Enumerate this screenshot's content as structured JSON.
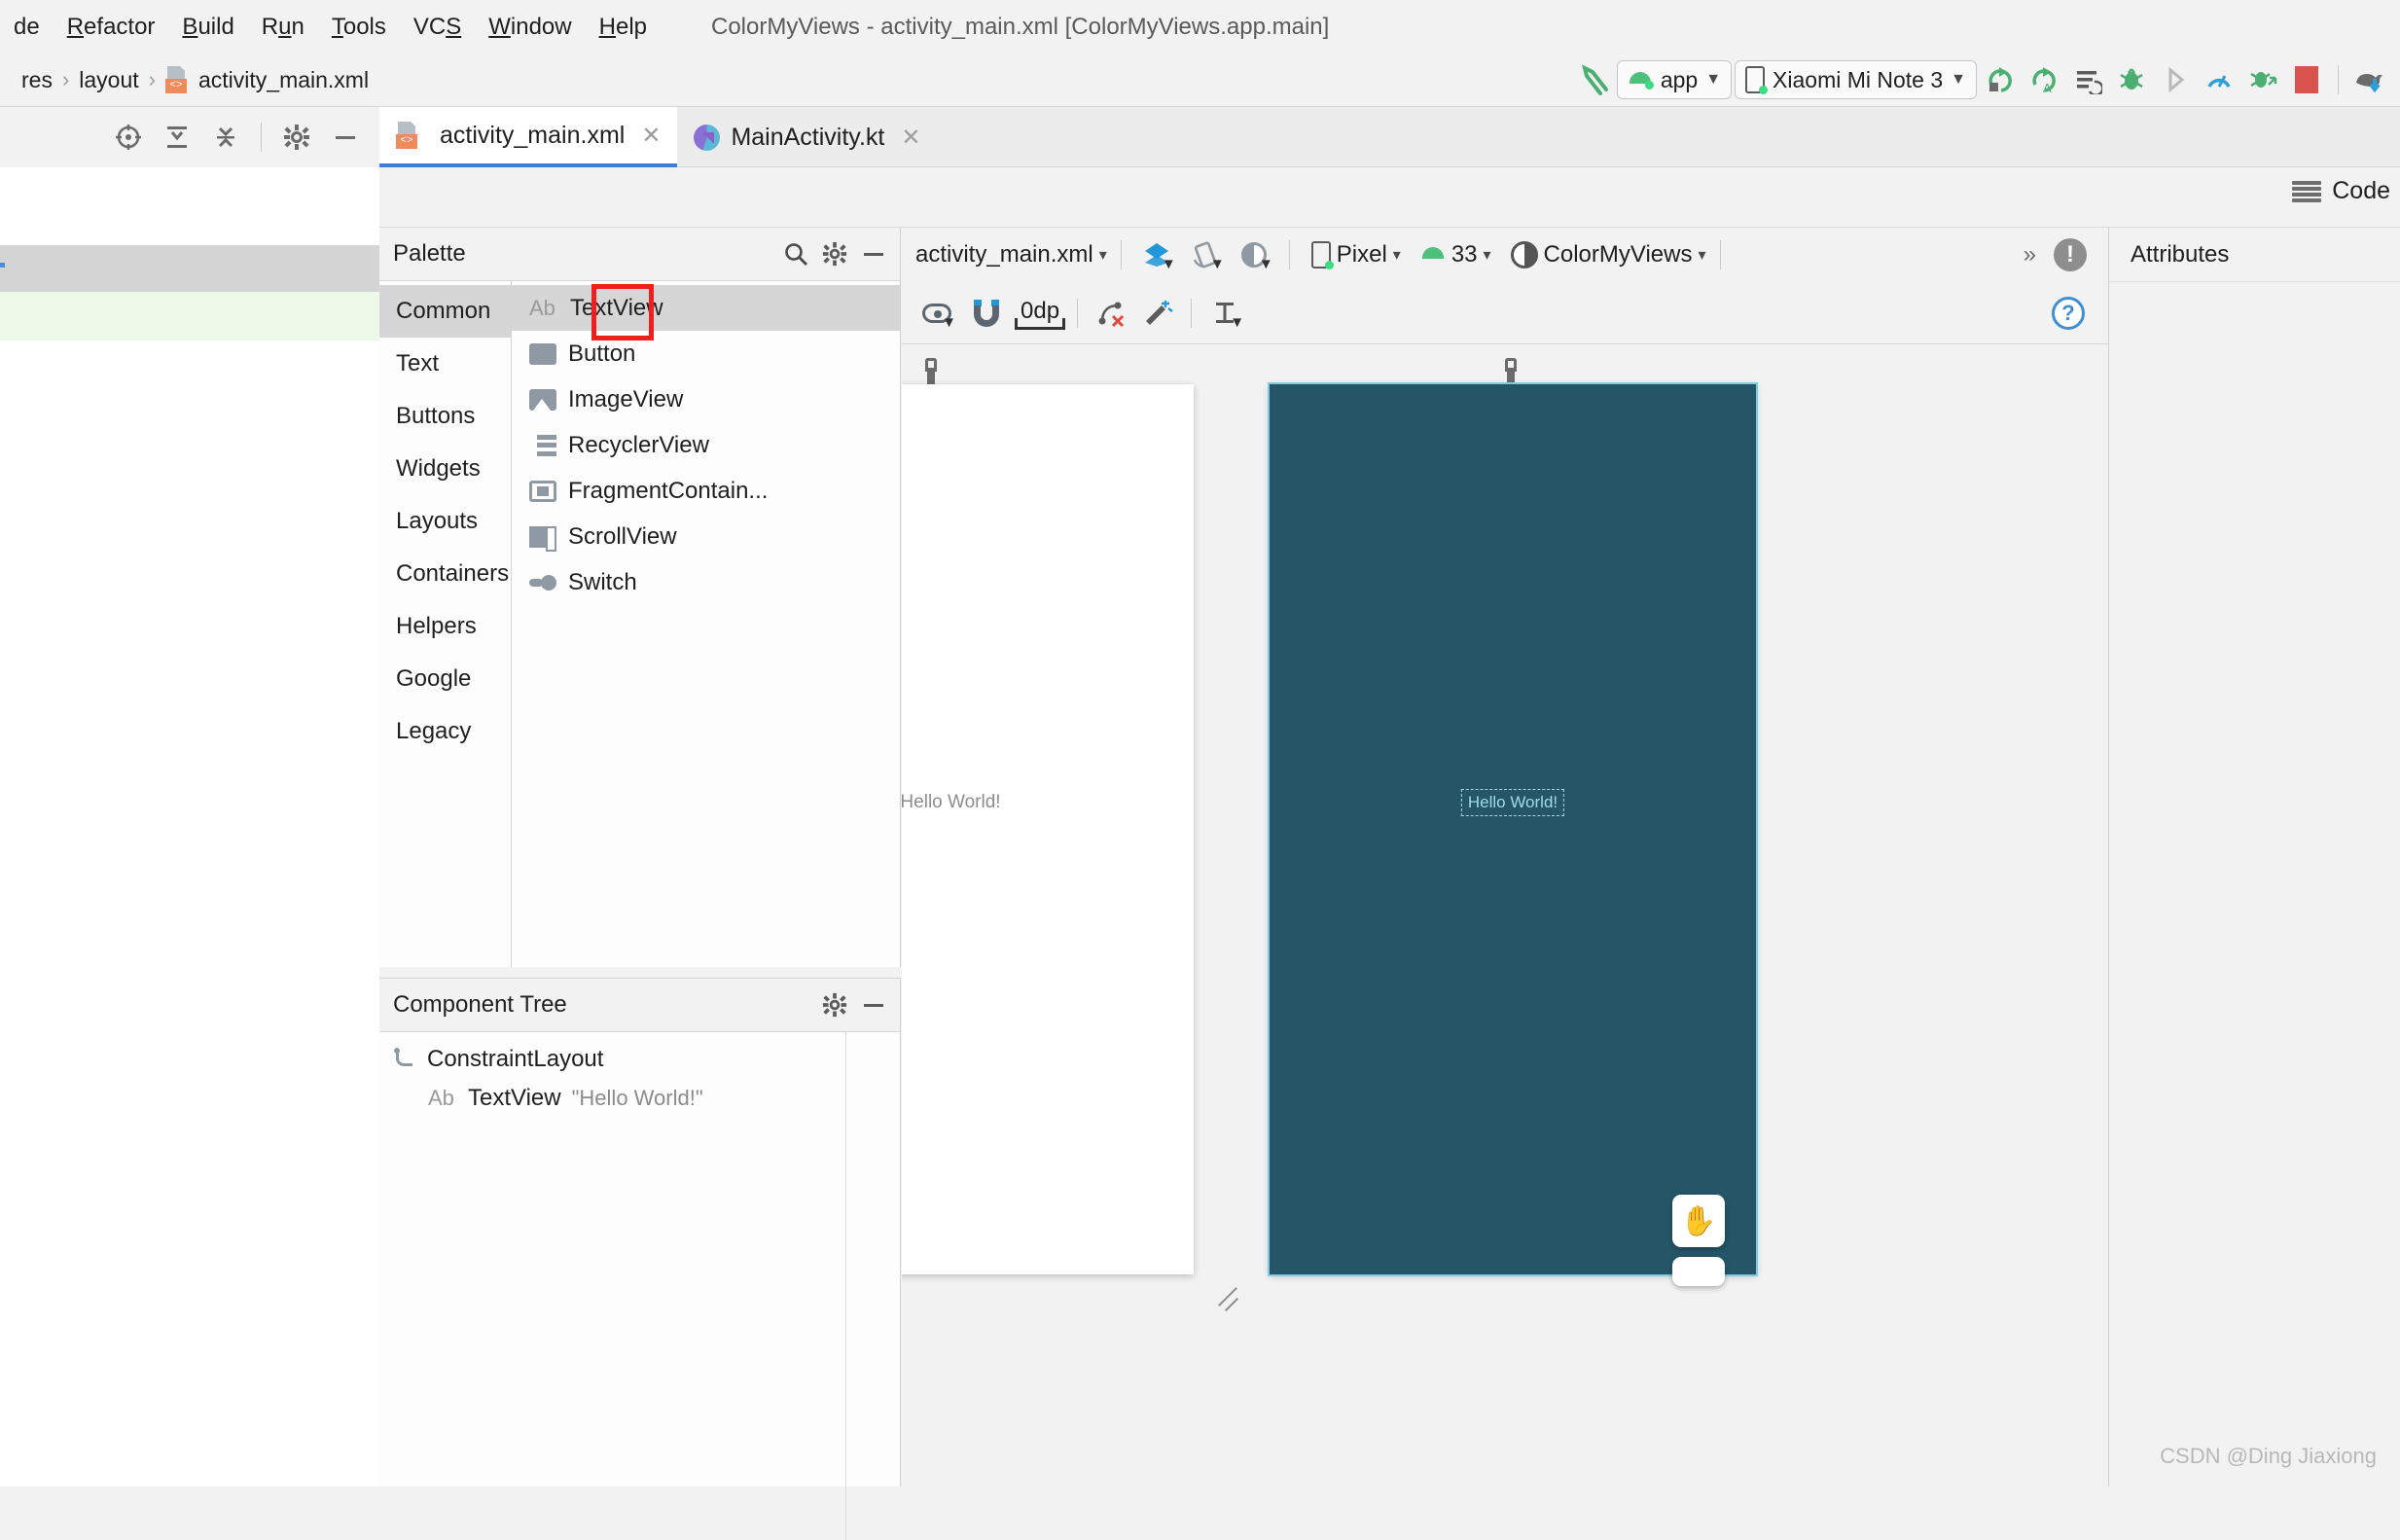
{
  "window": {
    "title": "ColorMyViews - activity_main.xml [ColorMyViews.app.main]"
  },
  "menubar": {
    "items": [
      {
        "label": "de",
        "mnemonic": ""
      },
      {
        "label": "Refactor",
        "mnemonic": "R"
      },
      {
        "label": "Build",
        "mnemonic": "B"
      },
      {
        "label": "Run",
        "mnemonic": "u"
      },
      {
        "label": "Tools",
        "mnemonic": "T"
      },
      {
        "label": "VCS",
        "mnemonic": "S"
      },
      {
        "label": "Window",
        "mnemonic": "W"
      },
      {
        "label": "Help",
        "mnemonic": "H"
      }
    ]
  },
  "breadcrumb": {
    "items": [
      "res",
      "layout",
      "activity_main.xml"
    ],
    "separator": "›"
  },
  "toolbar": {
    "run_config_label": "app",
    "device_label": "Xiaomi Mi Note 3",
    "icons": [
      "back-arrow-icon",
      "run-icon",
      "run-with-coverage-icon",
      "apply-changes-icon",
      "debug-icon",
      "step-icon",
      "profiler-icon",
      "attach-debugger-icon",
      "stop-icon",
      "gradle-sync-icon"
    ]
  },
  "left_tools": {
    "icons": [
      "target-icon",
      "expand-all-icon",
      "collapse-all-icon",
      "settings-icon",
      "hide-icon"
    ]
  },
  "tabs": [
    {
      "label": "activity_main.xml",
      "icon": "xml-layout-icon",
      "active": true,
      "close": "✕"
    },
    {
      "label": "MainActivity.kt",
      "icon": "kotlin-icon",
      "active": false,
      "close": "✕"
    }
  ],
  "editor_mode": {
    "label": "Code",
    "icon": "split-editor-icon"
  },
  "palette": {
    "title": "Palette",
    "actions": [
      "search-icon",
      "gear-icon",
      "minimize-icon"
    ],
    "categories": [
      {
        "label": "Common",
        "selected": true
      },
      {
        "label": "Text",
        "selected": false
      },
      {
        "label": "Buttons",
        "selected": false
      },
      {
        "label": "Widgets",
        "selected": false
      },
      {
        "label": "Layouts",
        "selected": false
      },
      {
        "label": "Containers",
        "selected": false
      },
      {
        "label": "Helpers",
        "selected": false
      },
      {
        "label": "Google",
        "selected": false
      },
      {
        "label": "Legacy",
        "selected": false
      }
    ],
    "items": [
      {
        "label": "TextView",
        "icon": "ab-icon",
        "selected": true
      },
      {
        "label": "Button",
        "icon": "button-icon",
        "selected": false
      },
      {
        "label": "ImageView",
        "icon": "image-icon",
        "selected": false
      },
      {
        "label": "RecyclerView",
        "icon": "list-icon",
        "selected": false
      },
      {
        "label": "FragmentContain...",
        "icon": "fragment-icon",
        "selected": false
      },
      {
        "label": "ScrollView",
        "icon": "scroll-icon",
        "selected": false
      },
      {
        "label": "Switch",
        "icon": "switch-icon",
        "selected": false
      }
    ]
  },
  "component_tree": {
    "title": "Component Tree",
    "actions": [
      "gear-icon",
      "minimize-icon"
    ],
    "nodes": [
      {
        "label": "ConstraintLayout",
        "value": "",
        "icon": "constraint-layout-icon",
        "level": 0
      },
      {
        "label": "TextView",
        "value": "\"Hello World!\"",
        "icon": "ab-icon",
        "level": 1
      }
    ]
  },
  "design_toolbar": {
    "file_label": "activity_main.xml",
    "device_label": "Pixel",
    "api_label": "33",
    "theme_label": "ColorMyViews",
    "overflow": "»",
    "icons": [
      "design-mode-icon",
      "orientation-icon",
      "night-mode-icon",
      "device-icon",
      "api-icon",
      "theme-icon",
      "issues-icon"
    ]
  },
  "constraint_toolbar": {
    "margin_value": "0dp",
    "highlighted_icon": "autoconnect-magnet-icon",
    "icons": [
      "view-options-eye-icon",
      "autoconnect-magnet-icon",
      "default-margin-icon",
      "clear-constraints-icon",
      "infer-constraints-icon",
      "align-icon",
      "help-icon"
    ]
  },
  "canvas": {
    "design_preview_text": "Hello World!",
    "blueprint_preview_text": "Hello World!",
    "blueprint_color": "#255668",
    "design_bg": "#ffffff",
    "surface_bg": "#f2f2f2",
    "pan_tool_icon": "hand-pan-icon",
    "wrench_icon": "wrench-icon"
  },
  "attributes": {
    "title": "Attributes"
  },
  "watermark": {
    "text": "CSDN @Ding Jiaxiong"
  },
  "accent": {
    "tab_underline": "#3f7fd4",
    "highlight_red": "#f01e1e",
    "android_green": "#3ddc84",
    "stop_red": "#d9534f"
  }
}
